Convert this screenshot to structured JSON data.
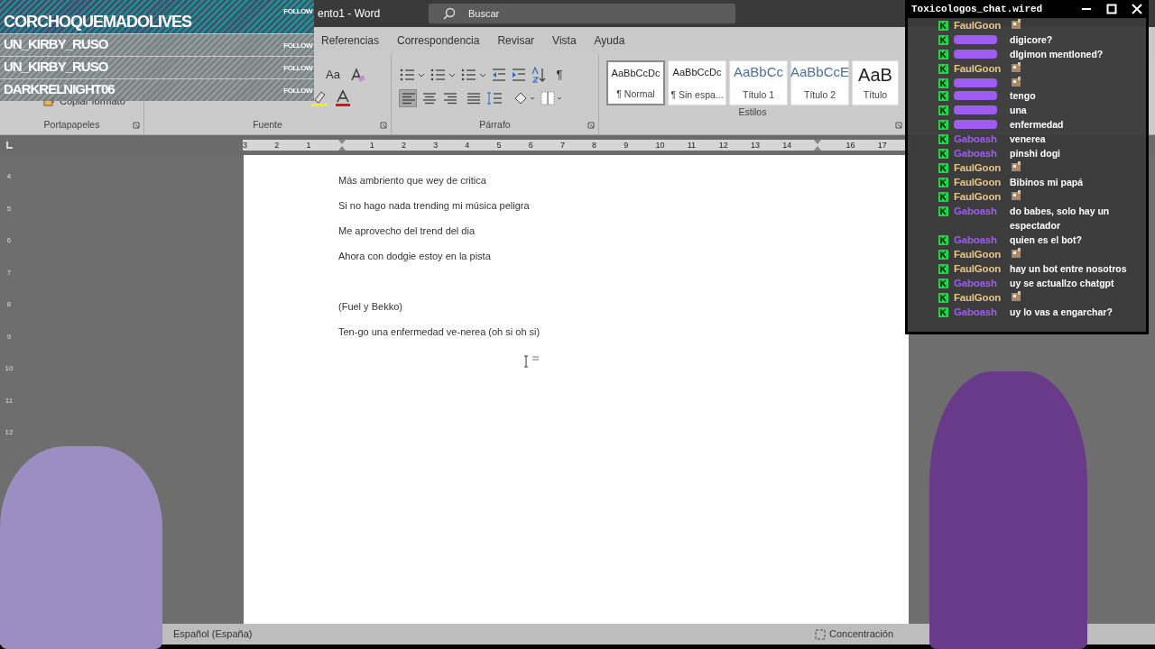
{
  "window": {
    "title": "ento1 - Word",
    "search": {
      "placeholder": "Buscar"
    }
  },
  "ribbon_tabs": [
    {
      "label": "Referencias",
      "selected": false
    },
    {
      "label": "Correspondencia",
      "selected": false
    },
    {
      "label": "Revisar",
      "selected": false
    },
    {
      "label": "Vista",
      "selected": false
    },
    {
      "label": "Ayuda",
      "selected": false
    }
  ],
  "ribbon": {
    "groups": [
      {
        "label": "Portapapeles",
        "kind": "clipboard",
        "copy_format": "Copiar formato"
      },
      {
        "label": "Fuente",
        "kind": "font",
        "case_button": "Aa"
      },
      {
        "label": "Párrafo",
        "kind": "paragraph",
        "paragraph_mark": "¶",
        "alignment": [
          {
            "selected": true
          },
          {
            "selected": false
          },
          {
            "selected": false
          },
          {
            "selected": false
          }
        ]
      },
      {
        "label": "Estilos",
        "kind": "styles",
        "styles": [
          {
            "preview": "AaBbCcDc",
            "label": "¶ Normal",
            "selected": true
          },
          {
            "preview": "AaBbCcDc",
            "label": "¶ Sin espa...",
            "selected": false
          },
          {
            "preview": "AaBbCc",
            "label": "Título 1",
            "selected": false
          },
          {
            "preview": "AaBbCcE",
            "label": "Título 2",
            "selected": false
          },
          {
            "preview": "AaB",
            "label": "Título",
            "selected": false
          }
        ]
      }
    ]
  },
  "ruler": [
    {
      "label": "3"
    },
    {
      "label": "2"
    },
    {
      "label": "1"
    },
    {
      "kind": "marker"
    },
    {
      "label": "1"
    },
    {
      "label": "2"
    },
    {
      "label": "3"
    },
    {
      "label": "4"
    },
    {
      "label": "5"
    },
    {
      "label": "6"
    },
    {
      "label": "7"
    },
    {
      "label": "8"
    },
    {
      "label": "9"
    },
    {
      "label": "10"
    },
    {
      "label": "11"
    },
    {
      "label": "12"
    },
    {
      "label": "13"
    },
    {
      "label": "14"
    },
    {
      "kind": "marker"
    },
    {
      "label": "16"
    },
    {
      "label": "17"
    }
  ],
  "vertical_ruler": [
    "4",
    "5",
    "6",
    "7",
    "8",
    "9",
    "10",
    "11",
    "12"
  ],
  "document": {
    "lines": [
      {
        "kind": "text",
        "text": "Más ambriento que wey de critica"
      },
      {
        "kind": "text",
        "text": "Si no hago nada trending mi música peligra"
      },
      {
        "kind": "text",
        "text": "Me aprovecho del trend del dia"
      },
      {
        "kind": "text",
        "text": "Ahora con dodgie estoy en la pista"
      },
      {
        "kind": "blank"
      },
      {
        "kind": "text",
        "text": "(Fuel y Bekko)"
      },
      {
        "kind": "text",
        "text": "Ten-go una enfermedad ve-nerea (oh si oh si)"
      }
    ]
  },
  "status_bar": {
    "language": "Español (España)",
    "focus": "Concentración"
  },
  "follow_overlay": [
    {
      "name": "CORCHOQUEMADOLIVES",
      "action": "FOLLOW"
    },
    {
      "name": "UN_KIRBY_RUSO",
      "action": "FOLLOW"
    },
    {
      "name": "UN_KIRBY_RUSO",
      "action": "FOLLOW"
    },
    {
      "name": "DARKRELNIGHT06",
      "action": "FOLLOW"
    }
  ],
  "chat_window": {
    "title": "Toxicologos_chat.wired",
    "messages": [
      {
        "name": "FaulGoon",
        "color": "#e6c58a",
        "kind": "emote"
      },
      {
        "kind": "hidden",
        "color": "#9f5cf2",
        "text": "digicore?"
      },
      {
        "kind": "hidden",
        "color": "#9f5cf2",
        "text": "dlgimon mentloned?"
      },
      {
        "name": "FaulGoon",
        "color": "#e6c58a",
        "kind": "emote"
      },
      {
        "kind": "hidden-emote",
        "color": "#9f5cf2"
      },
      {
        "kind": "hidden",
        "color": "#9f5cf2",
        "text": "tengo"
      },
      {
        "kind": "hidden",
        "color": "#9f5cf2",
        "text": "una"
      },
      {
        "kind": "hidden",
        "color": "#9f5cf2",
        "text": "enfermedad"
      },
      {
        "name": "Gaboash",
        "color": "#9f5cf2",
        "kind": "text",
        "text": "venerea"
      },
      {
        "name": "Gaboash",
        "color": "#9f5cf2",
        "kind": "text",
        "text": "pinshi dogi"
      },
      {
        "name": "FaulGoon",
        "color": "#e6c58a",
        "kind": "emote"
      },
      {
        "name": "FaulGoon",
        "color": "#e6c58a",
        "kind": "text",
        "text": "Bibinos mi papá"
      },
      {
        "name": "FaulGoon",
        "color": "#e6c58a",
        "kind": "emote"
      },
      {
        "name": "Gaboash",
        "color": "#9f5cf2",
        "kind": "text",
        "text": "do babes, solo hay un espectador"
      },
      {
        "name": "Gaboash",
        "color": "#9f5cf2",
        "kind": "text",
        "text": "quien es el bot?"
      },
      {
        "name": "FaulGoon",
        "color": "#e6c58a",
        "kind": "emote"
      },
      {
        "name": "FaulGoon",
        "color": "#e6c58a",
        "kind": "text",
        "text": "hay un bot entre nosotros"
      },
      {
        "name": "Gaboash",
        "color": "#9f5cf2",
        "kind": "text",
        "text": "uy se actuallzo chatgpt"
      },
      {
        "name": "FaulGoon",
        "color": "#e6c58a",
        "kind": "emote"
      },
      {
        "name": "Gaboash",
        "color": "#9f5cf2",
        "kind": "text",
        "text": "uy lo vas a engarchar?"
      }
    ]
  }
}
